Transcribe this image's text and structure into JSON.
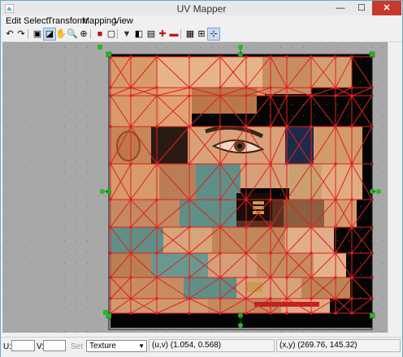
{
  "window": {
    "title": "UV Mapper"
  },
  "menu": [
    "Edit",
    "Select",
    "Transform",
    "Mapping",
    "View"
  ],
  "toolbar": {
    "buttons": [
      {
        "name": "undo-icon",
        "glyph": "↶"
      },
      {
        "name": "redo-icon",
        "glyph": "↷"
      },
      {
        "name": "show-texture-icon",
        "glyph": "▣"
      },
      {
        "name": "select-tool-icon",
        "glyph": "◪",
        "active": true
      },
      {
        "name": "pan-hand-icon",
        "glyph": "✋"
      },
      {
        "name": "zoom-icon",
        "glyph": "🔍"
      },
      {
        "name": "zoom-fit-icon",
        "glyph": "⊕"
      },
      {
        "name": "stop-icon",
        "glyph": "■"
      },
      {
        "name": "checkbox-icon",
        "glyph": "▢"
      },
      {
        "name": "filter-icon",
        "glyph": "▼"
      },
      {
        "name": "split-view-icon",
        "glyph": "◧"
      },
      {
        "name": "list-icon",
        "glyph": "▤"
      },
      {
        "name": "add-icon",
        "glyph": "✚"
      },
      {
        "name": "remove-icon",
        "glyph": "▬"
      },
      {
        "name": "grid-icon",
        "glyph": "▦"
      },
      {
        "name": "grid-dots-icon",
        "glyph": "⊞"
      },
      {
        "name": "snap-icon",
        "glyph": "⊹",
        "active": true
      }
    ]
  },
  "status": {
    "u_label": "U:",
    "u_value": "",
    "v_label": "V:",
    "v_value": "",
    "set_label": "Set",
    "mode_select": "Texture",
    "uv_readout": "(u,v) (1.054, 0.568)",
    "xy_readout": "(x,y) (269.76, 145.32)"
  },
  "colors": {
    "accent_red": "#e02020",
    "handle_green": "#27b827",
    "canvas_bg": "#a8a8a8",
    "skin": "#d89a6a"
  }
}
